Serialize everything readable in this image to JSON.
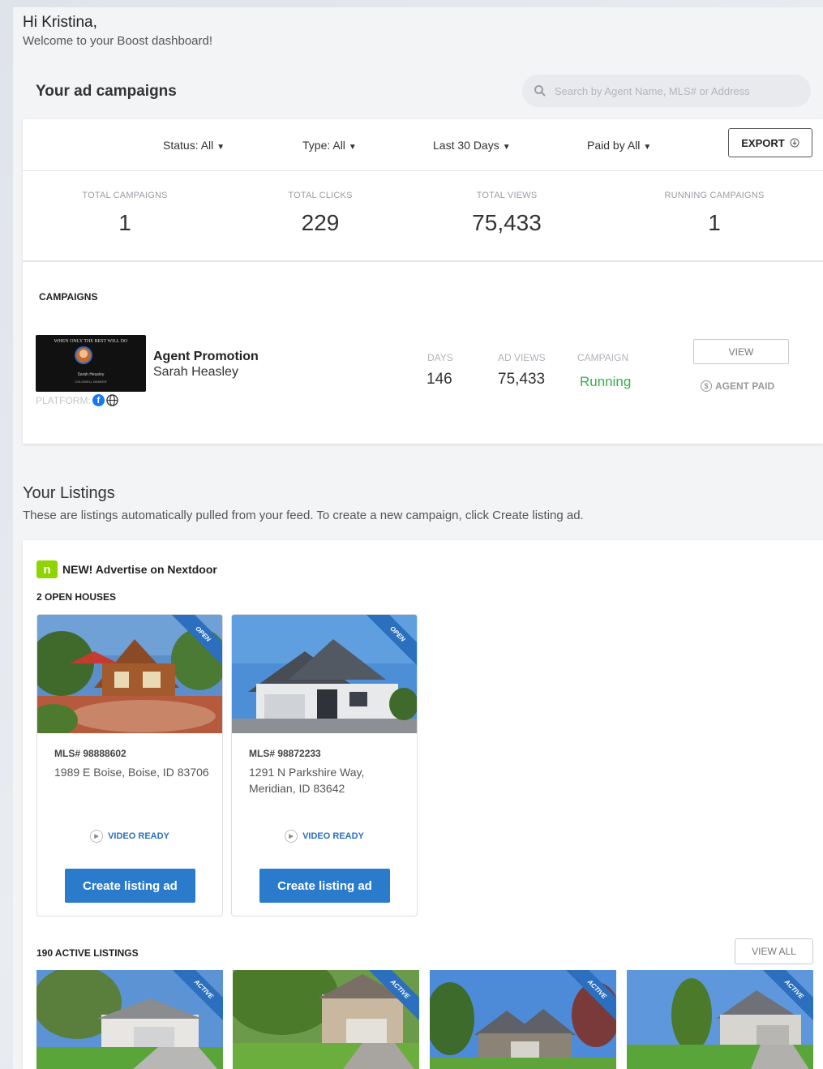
{
  "header": {
    "greeting": "Hi Kristina,",
    "welcome": "Welcome to your Boost dashboard!"
  },
  "campaigns_section": {
    "title": "Your ad campaigns",
    "search_placeholder": "Search by Agent Name, MLS# or Address",
    "filters": {
      "status": "Status: All",
      "type": "Type: All",
      "period": "Last 30 Days",
      "paid_by": "Paid by All"
    },
    "export_label": "EXPORT",
    "stats": [
      {
        "label": "TOTAL CAMPAIGNS",
        "value": "1"
      },
      {
        "label": "TOTAL CLICKS",
        "value": "229"
      },
      {
        "label": "TOTAL VIEWS",
        "value": "75,433"
      },
      {
        "label": "RUNNING CAMPAIGNS",
        "value": "1"
      }
    ],
    "campaigns_label": "CAMPAIGNS",
    "campaign": {
      "thumb_tagline": "WHEN ONLY THE BEST WILL DO",
      "thumb_name": "Sarah Heasley",
      "thumb_brand": "COLDWELL BANKER",
      "platform_label": "PLATFORM:",
      "title": "Agent Promotion",
      "agent": "Sarah Heasley",
      "days_label": "DAYS",
      "days": "146",
      "views_label": "AD VIEWS",
      "views": "75,433",
      "status_label": "CAMPAIGN",
      "status": "Running",
      "view_label": "VIEW",
      "paid_label": "AGENT PAID"
    }
  },
  "listings_section": {
    "title": "Your Listings",
    "subtitle": "These are listings automatically pulled from your feed. To create a new campaign, click Create listing ad.",
    "nextdoor_label": "NEW! Advertise on Nextdoor",
    "open_houses_label": "2 OPEN HOUSES",
    "open_houses": [
      {
        "ribbon": "OPEN",
        "mls": "MLS# 98888602",
        "address": "1989 E Boise, Boise, ID 83706",
        "video": "VIDEO READY",
        "button": "Create listing ad"
      },
      {
        "ribbon": "OPEN",
        "mls": "MLS# 98872233",
        "address": "1291 N Parkshire Way, Meridian, ID 83642",
        "video": "VIDEO READY",
        "button": "Create listing ad"
      }
    ],
    "active_label": "190 ACTIVE LISTINGS",
    "view_all_label": "VIEW ALL",
    "active_ribbons": [
      "ACTIVE",
      "ACTIVE",
      "ACTIVE",
      "ACTIVE"
    ]
  },
  "colors": {
    "primary": "#2b7bcc",
    "running": "#34b04a",
    "nextdoor": "#8ed500",
    "facebook": "#1877f2"
  },
  "icons": [
    "search-icon",
    "export-icon",
    "facebook-icon",
    "globe-icon",
    "coin-icon",
    "nextdoor-icon",
    "play-icon"
  ]
}
